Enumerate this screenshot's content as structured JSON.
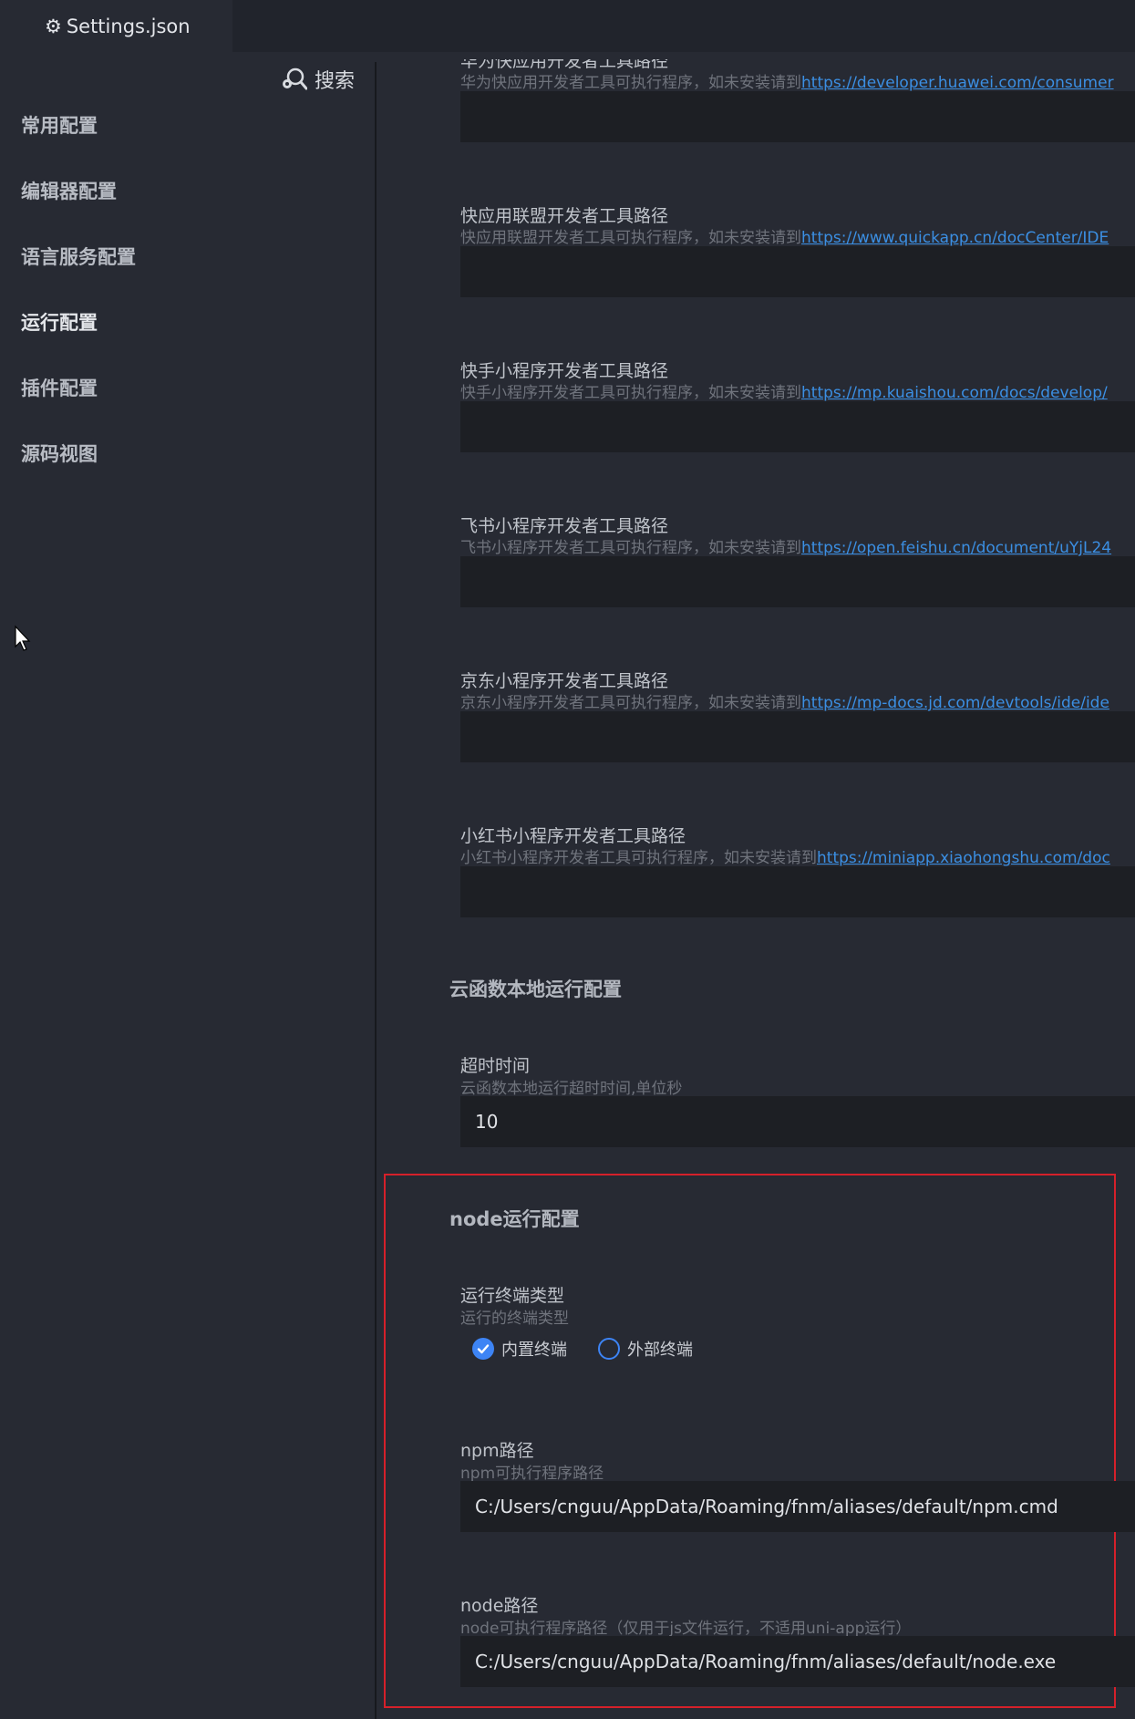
{
  "tab": {
    "title": "Settings.json"
  },
  "search": {
    "label": "搜索"
  },
  "sidebar": {
    "items": [
      {
        "label": "常用配置"
      },
      {
        "label": "编辑器配置"
      },
      {
        "label": "语言服务配置"
      },
      {
        "label": "运行配置"
      },
      {
        "label": "插件配置"
      },
      {
        "label": "源码视图"
      }
    ],
    "active_item": "运行配置"
  },
  "settings": {
    "huawei": {
      "title": "华为快应用开发者工具路径",
      "desc_prefix": "华为快应用开发者工具可执行程序，如未安装请到",
      "link": "https://developer.huawei.com/consumer",
      "value": ""
    },
    "quickapp": {
      "title": "快应用联盟开发者工具路径",
      "desc_prefix": "快应用联盟开发者工具可执行程序，如未安装请到",
      "link": "https://www.quickapp.cn/docCenter/IDE",
      "value": ""
    },
    "kuaishou": {
      "title": "快手小程序开发者工具路径",
      "desc_prefix": "快手小程序开发者工具可执行程序，如未安装请到",
      "link": "https://mp.kuaishou.com/docs/develop/",
      "value": ""
    },
    "feishu": {
      "title": "飞书小程序开发者工具路径",
      "desc_prefix": "飞书小程序开发者工具可执行程序，如未安装请到",
      "link": "https://open.feishu.cn/document/uYjL24",
      "value": ""
    },
    "jd": {
      "title": "京东小程序开发者工具路径",
      "desc_prefix": "京东小程序开发者工具可执行程序，如未安装请到",
      "link": "https://mp-docs.jd.com/devtools/ide/ide",
      "value": ""
    },
    "xiaohongshu": {
      "title": "小红书小程序开发者工具路径",
      "desc_prefix": "小红书小程序开发者工具可执行程序，如未安装请到",
      "link": "https://miniapp.xiaohongshu.com/doc",
      "value": ""
    }
  },
  "cloud": {
    "heading": "云函数本地运行配置",
    "timeout": {
      "title": "超时时间",
      "desc": "云函数本地运行超时时间,单位秒",
      "value": "10"
    }
  },
  "node_config": {
    "heading": "node运行配置",
    "terminal": {
      "title": "运行终端类型",
      "desc": "运行的终端类型",
      "options": [
        "内置终端",
        "外部终端"
      ],
      "selected": "内置终端"
    },
    "npm": {
      "title": "npm路径",
      "desc": "npm可执行程序路径",
      "value": "C:/Users/cnguu/AppData/Roaming/fnm/aliases/default/npm.cmd"
    },
    "node": {
      "title": "node路径",
      "desc": "node可执行程序路径（仅用于js文件运行，不适用uni-app运行）",
      "value": "C:/Users/cnguu/AppData/Roaming/fnm/aliases/default/node.exe"
    }
  },
  "colors": {
    "accent": "#3d84f5",
    "link": "#3b8fe3",
    "highlight_border": "#d5202a"
  }
}
